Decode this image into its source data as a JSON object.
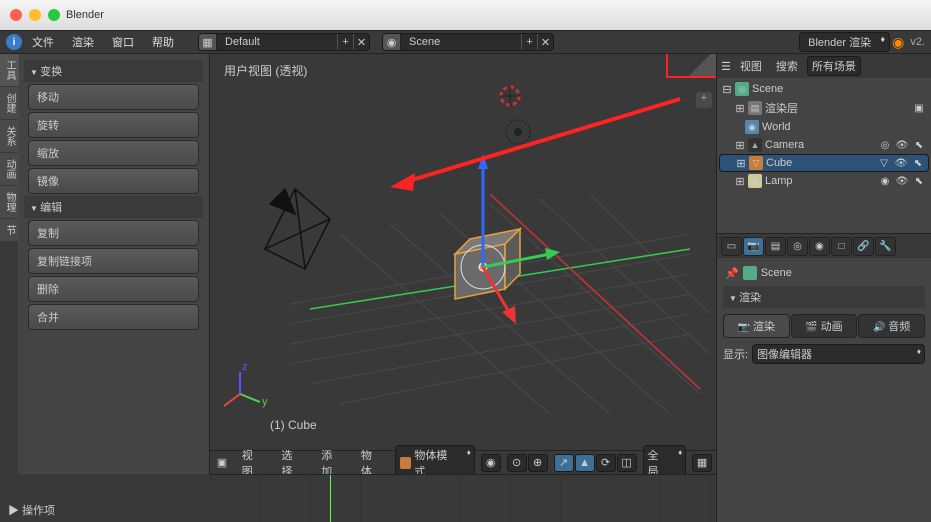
{
  "app": {
    "title": "Blender"
  },
  "topmenu": {
    "items": [
      "文件",
      "渲染",
      "窗口",
      "帮助"
    ],
    "layout": "Default",
    "scene": "Scene",
    "engine": "Blender 渲染",
    "version": "v2."
  },
  "toolshelf": {
    "tabs": [
      "工具",
      "创建",
      "关系",
      "动画",
      "物理",
      "节"
    ],
    "panels": {
      "transform": {
        "title": "变换",
        "items": [
          "移动",
          "旋转",
          "缩放",
          "镜像"
        ]
      },
      "edit": {
        "title": "编辑",
        "items": [
          "复制",
          "复制链接项",
          "删除",
          "合并"
        ]
      }
    },
    "operator": "操作项"
  },
  "viewport": {
    "label": "用户视图 (透视)",
    "active_object": "(1) Cube",
    "header": {
      "menus": [
        "视图",
        "选择",
        "添加",
        "物体"
      ],
      "mode": "物体模式",
      "orientation": "全局"
    }
  },
  "outliner": {
    "menus": [
      "视图",
      "搜索"
    ],
    "filter": "所有场景",
    "root": "Scene",
    "items": [
      {
        "name": "渲染层",
        "icon": "layers",
        "depth": 1
      },
      {
        "name": "World",
        "icon": "world",
        "depth": 1
      },
      {
        "name": "Camera",
        "icon": "cam",
        "depth": 1,
        "toggles": true
      },
      {
        "name": "Cube",
        "icon": "mesh",
        "depth": 1,
        "toggles": true,
        "selected": true
      },
      {
        "name": "Lamp",
        "icon": "lamp",
        "depth": 1,
        "toggles": true
      }
    ]
  },
  "properties": {
    "scene_name": "Scene",
    "panel_render": "渲染",
    "tabs": [
      "渲染",
      "动画",
      "音频"
    ],
    "display_label": "显示:",
    "display_value": "图像编辑器"
  }
}
